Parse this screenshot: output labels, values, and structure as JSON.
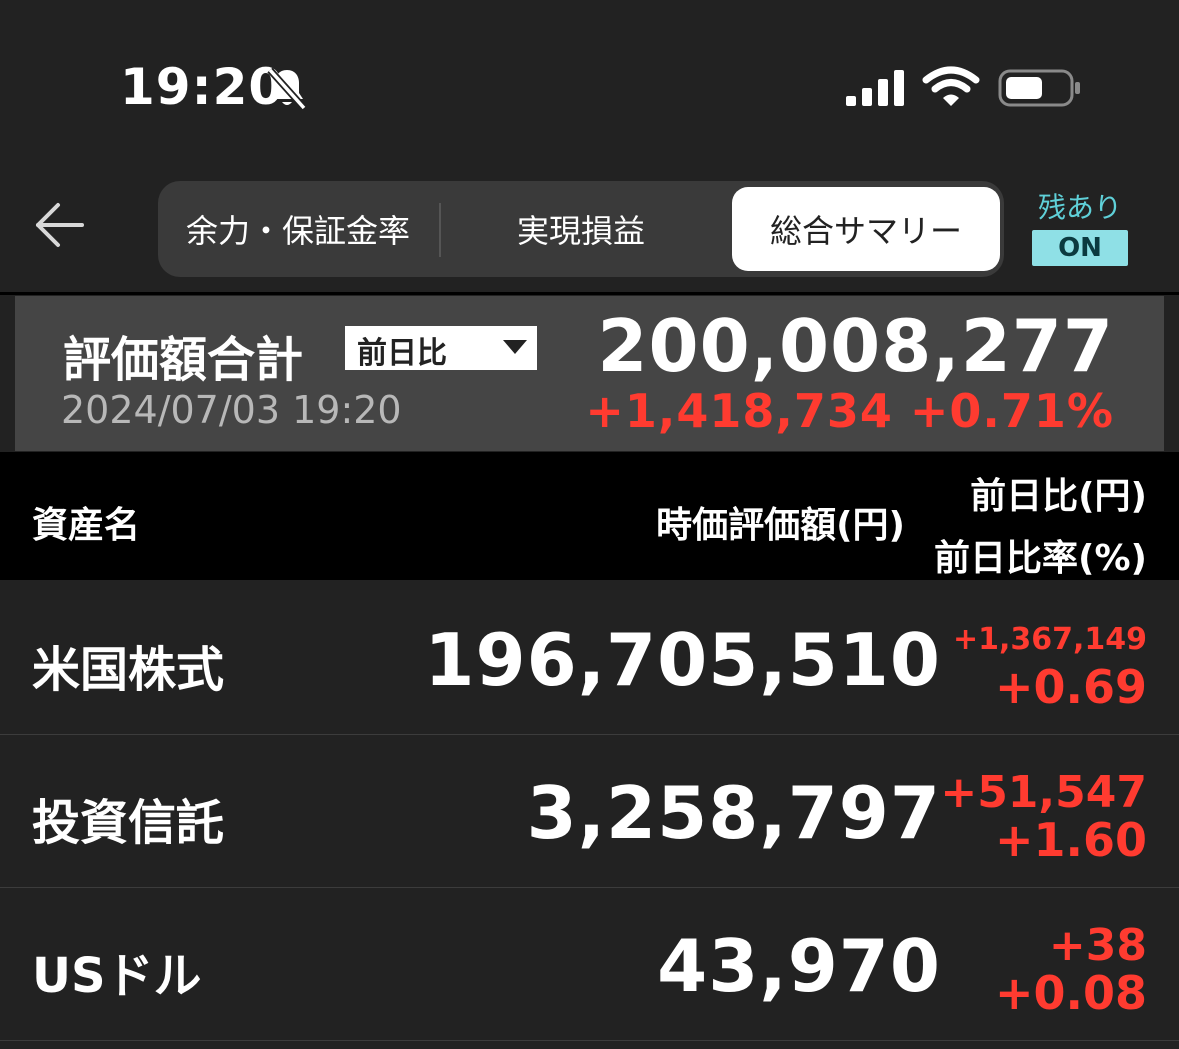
{
  "status_bar": {
    "time": "19:20"
  },
  "nav": {
    "tabs": [
      {
        "label": "余力・保証金率"
      },
      {
        "label": "実現損益"
      },
      {
        "label": "総合サマリー"
      }
    ],
    "zan_label": "残あり",
    "zan_toggle": "ON"
  },
  "summary": {
    "title": "評価額合計",
    "compare_select": "前日比",
    "datetime": "2024/07/03 19:20",
    "total": "200,008,277",
    "change": "+1,418,734 +0.71%"
  },
  "table": {
    "headers": {
      "name": "資産名",
      "value": "時価評価額(円)",
      "change_yen": "前日比(円)",
      "change_pct": "前日比率(%)"
    },
    "rows": [
      {
        "name": "米国株式",
        "value": "196,705,510",
        "change_yen": "+1,367,149",
        "change_pct": "+0.69"
      },
      {
        "name": "投資信託",
        "value": "3,258,797",
        "change_yen": "+51,547",
        "change_pct": "+1.60"
      },
      {
        "name": "USドル",
        "value": "43,970",
        "change_yen": "+38",
        "change_pct": "+0.08"
      }
    ]
  },
  "colors": {
    "negative_change": "#ff3b30",
    "accent": "#5fd0d8",
    "background": "#222222"
  }
}
